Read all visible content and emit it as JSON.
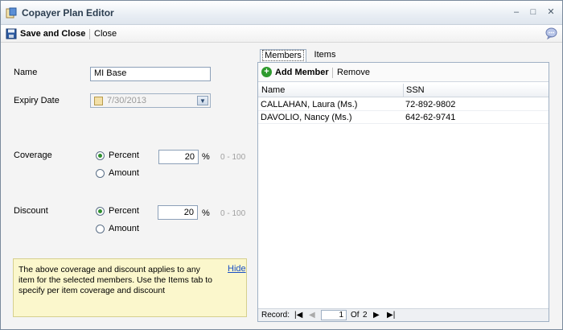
{
  "window": {
    "title": "Copayer Plan Editor",
    "controls": {
      "minimize": "–",
      "maximize": "□",
      "close": "✕"
    }
  },
  "toolbar": {
    "save_close_label": "Save and Close",
    "close_label": "Close",
    "save_icon": "floppy-disk-icon",
    "help_icon": "help-icon"
  },
  "form": {
    "name_label": "Name",
    "name_value": "MI Base",
    "expiry_label": "Expiry Date",
    "expiry_value": "7/30/2013",
    "coverage": {
      "label": "Coverage",
      "option_percent": "Percent",
      "option_amount": "Amount",
      "selected": "Percent",
      "value": "20",
      "unit": "%",
      "range": "0 - 100"
    },
    "discount": {
      "label": "Discount",
      "option_percent": "Percent",
      "option_amount": "Amount",
      "selected": "Percent",
      "value": "20",
      "unit": "%",
      "range": "0 - 100"
    }
  },
  "note": {
    "text": "The above coverage and discount applies to any item for the selected members. Use the Items tab to specify per item coverage and discount",
    "hide_label": "Hide"
  },
  "tabs": [
    {
      "label": "Members",
      "active": true
    },
    {
      "label": "Items",
      "active": false
    }
  ],
  "members": {
    "add_label": "Add Member",
    "remove_label": "Remove",
    "columns": [
      "Name",
      "SSN"
    ],
    "rows": [
      {
        "name": "CALLAHAN, Laura (Ms.)",
        "ssn": "72-892-9802"
      },
      {
        "name": "DAVOLIO, Nancy (Ms.)",
        "ssn": "642-62-9741"
      }
    ],
    "pager": {
      "record_label": "Record:",
      "current": "1",
      "of_label": "Of",
      "total": "2"
    }
  },
  "colors": {
    "accent_green": "#2e9a2e",
    "link_blue": "#1a4fc4",
    "note_bg": "#fbf7cc"
  }
}
